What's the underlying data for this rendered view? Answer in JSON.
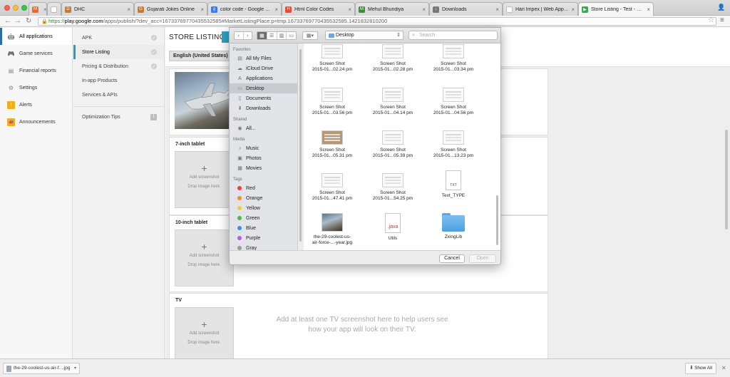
{
  "browser": {
    "tabs": [
      {
        "label": "",
        "fav_color": "#e86a2b",
        "fav_glyph": "M"
      },
      {
        "label": "",
        "fav_color": "#ffffff",
        "fav_glyph": ""
      },
      {
        "label": "DHC",
        "fav_color": "#c87a2a",
        "fav_glyph": "D"
      },
      {
        "label": "Gujarati Jokes Online",
        "fav_color": "#c87a2a",
        "fav_glyph": "G"
      },
      {
        "label": "color code - Google Search",
        "fav_color": "#3b78e7",
        "fav_glyph": "g"
      },
      {
        "label": "Html Color Codes",
        "fav_color": "#e04c3c",
        "fav_glyph": "H"
      },
      {
        "label": "Mehul Bhundiya",
        "fav_color": "#3b8d3b",
        "fav_glyph": "M"
      },
      {
        "label": "Downloads",
        "fav_color": "#777777",
        "fav_glyph": "↓"
      },
      {
        "label": "Hari Impex | Web Applicatio",
        "fav_color": "#ffffff",
        "fav_glyph": ""
      },
      {
        "label": "Store Listing - Test - Goog",
        "fav_color": "#3aa757",
        "fav_glyph": "▶"
      }
    ],
    "url_scheme": "https://",
    "url_host": "play.google.com",
    "url_rest": "/apps/publish/?dev_acc=16733769770435532585#MarketListingPlace:p=tmp.16733769770435532585.1421832810200"
  },
  "app_nav": {
    "items": [
      {
        "label": "All applications",
        "icon": "android-icon",
        "glyph": "🤖",
        "active": true
      },
      {
        "label": "Game services",
        "icon": "gamepad-icon",
        "glyph": "🎮"
      },
      {
        "label": "Financial reports",
        "icon": "report-icon",
        "glyph": "▤"
      },
      {
        "label": "Settings",
        "icon": "gear-icon",
        "glyph": "⚙"
      },
      {
        "label": "Alerts",
        "icon": "alert-icon",
        "glyph": "!"
      },
      {
        "label": "Announcements",
        "icon": "megaphone-icon",
        "glyph": "📣"
      }
    ]
  },
  "sub_nav": {
    "items": [
      {
        "label": "APK"
      },
      {
        "label": "Store Listing",
        "active": true
      },
      {
        "label": "Pricing & Distribution"
      },
      {
        "label": "In-app Products"
      },
      {
        "label": "Services & APIs"
      }
    ],
    "optimization_tips": "Optimization Tips",
    "optimization_badge": "1"
  },
  "main": {
    "title": "STORE LISTING",
    "language": "English (United States) –",
    "seven_inch_title": "7-inch tablet",
    "ten_inch_title": "10-inch tablet",
    "tv_title": "TV",
    "add_screenshot": "Add screenshot",
    "drop_image": "Drop image here.",
    "tv_hint": "Add at least one TV screenshot here to help users see how your app will look on their TV."
  },
  "dialog": {
    "location": "Desktop",
    "search_placeholder": "Search",
    "favorites_header": "Favorites",
    "favorites": [
      {
        "label": "All My Files",
        "icon": "all-files-icon",
        "glyph": "▤"
      },
      {
        "label": "iCloud Drive",
        "icon": "cloud-icon",
        "glyph": "☁"
      },
      {
        "label": "Applications",
        "icon": "applications-icon",
        "glyph": "A"
      },
      {
        "label": "Desktop",
        "icon": "desktop-icon",
        "glyph": "▭",
        "selected": true
      },
      {
        "label": "Documents",
        "icon": "documents-icon",
        "glyph": "▯"
      },
      {
        "label": "Downloads",
        "icon": "downloads-icon",
        "glyph": "⬇"
      }
    ],
    "shared_header": "Shared",
    "shared": [
      {
        "label": "All...",
        "icon": "network-icon",
        "glyph": "◉"
      }
    ],
    "media_header": "Media",
    "media": [
      {
        "label": "Music",
        "icon": "music-icon",
        "glyph": "♪"
      },
      {
        "label": "Photos",
        "icon": "photos-icon",
        "glyph": "▣"
      },
      {
        "label": "Movies",
        "icon": "movies-icon",
        "glyph": "▦"
      }
    ],
    "tags_header": "Tags",
    "tags": [
      {
        "label": "Red",
        "color": "#e8433a"
      },
      {
        "label": "Orange",
        "color": "#f08c2a"
      },
      {
        "label": "Yellow",
        "color": "#f5c831"
      },
      {
        "label": "Green",
        "color": "#4cb94c"
      },
      {
        "label": "Blue",
        "color": "#3b8ee8"
      },
      {
        "label": "Purple",
        "color": "#b45dd6"
      },
      {
        "label": "Gray",
        "color": "#9a9a9a"
      }
    ],
    "files": [
      {
        "line1": "Screen Shot",
        "line2": "2015-01...02.24 pm",
        "kind": "shot"
      },
      {
        "line1": "Screen Shot",
        "line2": "2015-01...02.28 pm",
        "kind": "shot"
      },
      {
        "line1": "Screen Shot",
        "line2": "2015-01...03.34 pm",
        "kind": "shot"
      },
      {
        "line1": "Screen Shot",
        "line2": "2015-01...03.56 pm",
        "kind": "shot"
      },
      {
        "line1": "Screen Shot",
        "line2": "2015-01...04.14 pm",
        "kind": "shot"
      },
      {
        "line1": "Screen Shot",
        "line2": "2015-01...04.56 pm",
        "kind": "shot"
      },
      {
        "line1": "Screen Shot",
        "line2": "2015-01...05.31 pm",
        "kind": "brown"
      },
      {
        "line1": "Screen Shot",
        "line2": "2015-01...05.39 pm",
        "kind": "shot"
      },
      {
        "line1": "Screen Shot",
        "line2": "2015-01...13.23 pm",
        "kind": "shot"
      },
      {
        "line1": "Screen Shot",
        "line2": "2015-01...47.41 pm",
        "kind": "shot"
      },
      {
        "line1": "Screen Shot",
        "line2": "2015-01...54.25 pm",
        "kind": "shot"
      },
      {
        "line1": "Text_TYPE",
        "line2": "",
        "kind": "txt"
      },
      {
        "line1": "the-29-coolest-us-",
        "line2": "air-force-...-year.jpg",
        "kind": "jpg"
      },
      {
        "line1": "Utils",
        "line2": "",
        "kind": "java"
      },
      {
        "line1": "ZxingLib",
        "line2": "",
        "kind": "folder"
      }
    ],
    "txt_label": "TXT",
    "java_label": ".java",
    "cancel": "Cancel",
    "open": "Open"
  },
  "shelf": {
    "download_name": "the-29-coolest-us-air-f....jpg",
    "show_all": "Show All"
  }
}
